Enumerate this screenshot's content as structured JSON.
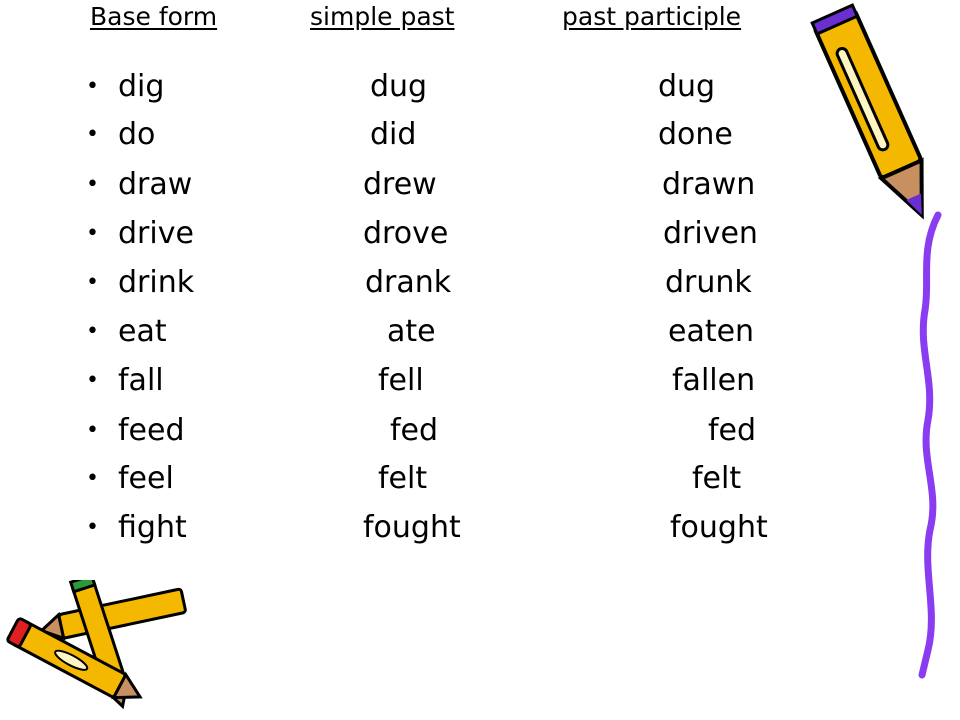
{
  "headers": {
    "base": "Base form",
    "past": "simple past",
    "participle": "past participle"
  },
  "bullet": "•",
  "rows": [
    {
      "base": "dig",
      "past": "dug",
      "participle": "dug"
    },
    {
      "base": "do",
      "past": "did",
      "participle": "done"
    },
    {
      "base": "draw",
      "past": "drew",
      "participle": "drawn"
    },
    {
      "base": "drive",
      "past": "drove",
      "participle": "driven"
    },
    {
      "base": "drink",
      "past": "drank",
      "participle": "drunk"
    },
    {
      "base": "eat",
      "past": "ate",
      "participle": "eaten"
    },
    {
      "base": "fall",
      "past": "fell",
      "participle": "fallen"
    },
    {
      "base": "feed",
      "past": "fed",
      "participle": "fed"
    },
    {
      "base": "feel",
      "past": "felt",
      "participle": "felt"
    },
    {
      "base": "fight",
      "past": "fought",
      "participle": "fought"
    }
  ],
  "colors": {
    "pencil_body": "#f5b800",
    "accent_line": "#8a3cf0",
    "pencil_tip_red": "#e02020",
    "pencil_green": "#2a9a3a"
  },
  "icons": [
    "pencil-icon",
    "crossed-pencils-icon"
  ]
}
